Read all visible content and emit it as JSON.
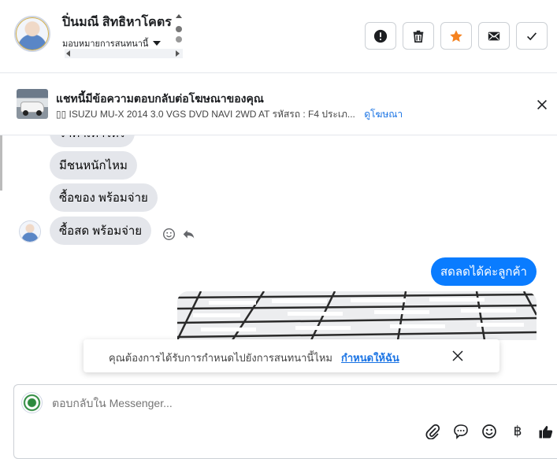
{
  "header": {
    "contact_name": "ปิ่นมณี สิทธิหาโคตร",
    "assign_label": "มอบหมายการสนทนานี้",
    "actions": [
      {
        "name": "mark-spam-button",
        "icon": "alert-circle-icon"
      },
      {
        "name": "delete-button",
        "icon": "trash-icon"
      },
      {
        "name": "star-button",
        "icon": "star-icon",
        "color": "#f5821f"
      },
      {
        "name": "mark-unread-button",
        "icon": "envelope-icon"
      },
      {
        "name": "mark-done-button",
        "icon": "check-icon"
      }
    ]
  },
  "ad_banner": {
    "title": "แชทนี้มีข้อความตอบกลับต่อโฆษณาของคุณ",
    "subtitle": "▯▯ ISUZU MU-X 2014 3.0 VGS DVD NAVI 2WD AT รหัสรถ : F4 ประเภ...",
    "view_ad_link": "ดูโฆษณา"
  },
  "messages": {
    "incoming": [
      {
        "text": "ราคาเท่าไหร่"
      },
      {
        "text": "มีชนหนักไหม"
      },
      {
        "text": "ซื้อของ พร้อมจ่าย"
      },
      {
        "text": "ซื้อสด พร้อมจ่าย"
      }
    ],
    "outgoing": [
      {
        "text": "สดลดได้ค่ะลูกค้า"
      }
    ]
  },
  "assign_prompt": {
    "text": "คุณต้องการได้รับการกำหนดไปยังการสนทนานี้ไหม",
    "link": "กำหนดให้ฉัน"
  },
  "composer": {
    "placeholder": "ตอบกลับใน Messenger...",
    "tools": [
      "attach-icon",
      "chat-bubble-icon",
      "emoji-icon",
      "baht-icon",
      "thumbs-up-icon"
    ],
    "baht_symbol": "฿"
  },
  "colors": {
    "accent": "#0a7cff",
    "link": "#1b74e4",
    "incoming_bubble": "#e4e6eb",
    "star": "#f5821f"
  }
}
